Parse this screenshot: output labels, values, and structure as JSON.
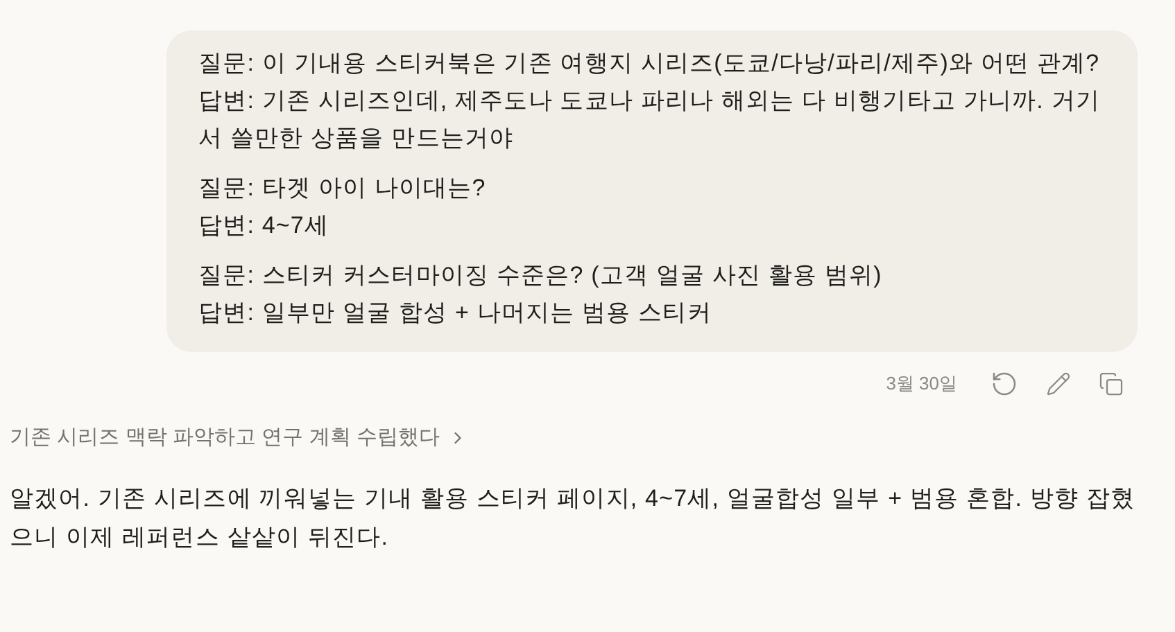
{
  "user_message": {
    "qa": [
      {
        "question": "질문: 이 기내용 스티커북은 기존 여행지 시리즈(도쿄/다낭/파리/제주)와 어떤 관계?",
        "answer": "답변: 기존 시리즈인데, 제주도나 도쿄나 파리나 해외는 다 비행기타고 가니까. 거기서 쓸만한 상품을 만드는거야"
      },
      {
        "question": "질문: 타겟 아이 나이대는?",
        "answer": "답변: 4~7세"
      },
      {
        "question": "질문: 스티커 커스터마이징 수준은? (고객 얼굴 사진 활용 범위)",
        "answer": "답변: 일부만 얼굴 합성 + 나머지는 범용 스티커"
      }
    ],
    "date": "3월 30일"
  },
  "thinking_summary": {
    "text": "기존 시리즈 맥락 파악하고 연구 계획 수립했다",
    "expanded": false
  },
  "assistant_message": {
    "paragraph": "알겠어. 기존 시리즈에 끼워넣는 기내 활용 스티커 페이지, 4~7세, 얼굴합성 일부 + 범용 혼합. 방향 잡혔으니 이제 레퍼런스 샅샅이 뒤진다."
  }
}
